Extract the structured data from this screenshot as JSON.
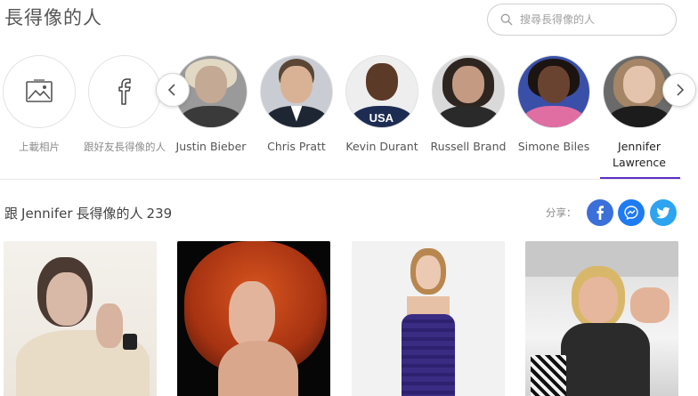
{
  "page": {
    "title": "長得像的人"
  },
  "search": {
    "placeholder": "搜尋長得像的人"
  },
  "people": [
    {
      "label": "上載相片",
      "type": "upload"
    },
    {
      "label": "跟好友長得像的人",
      "type": "facebook"
    },
    {
      "label": "Justin Bieber",
      "type": "person"
    },
    {
      "label": "Chris Pratt",
      "type": "person"
    },
    {
      "label": "Kevin Durant",
      "type": "person"
    },
    {
      "label": "Russell Brand",
      "type": "person"
    },
    {
      "label": "Simone Biles",
      "type": "person"
    },
    {
      "label": "Jennifer Lawrence",
      "type": "person",
      "active": true
    }
  ],
  "results": {
    "prefix": "跟",
    "name": "Jennifer",
    "suffix": "長得像的人",
    "count": "239"
  },
  "share": {
    "label": "分享：",
    "icons": [
      "facebook-icon",
      "messenger-icon",
      "twitter-icon"
    ]
  },
  "colors": {
    "accent": "#5b2fc4",
    "facebook": "#3b6fd9",
    "messenger": "#1f7bf2",
    "twitter": "#2ea4f0"
  }
}
